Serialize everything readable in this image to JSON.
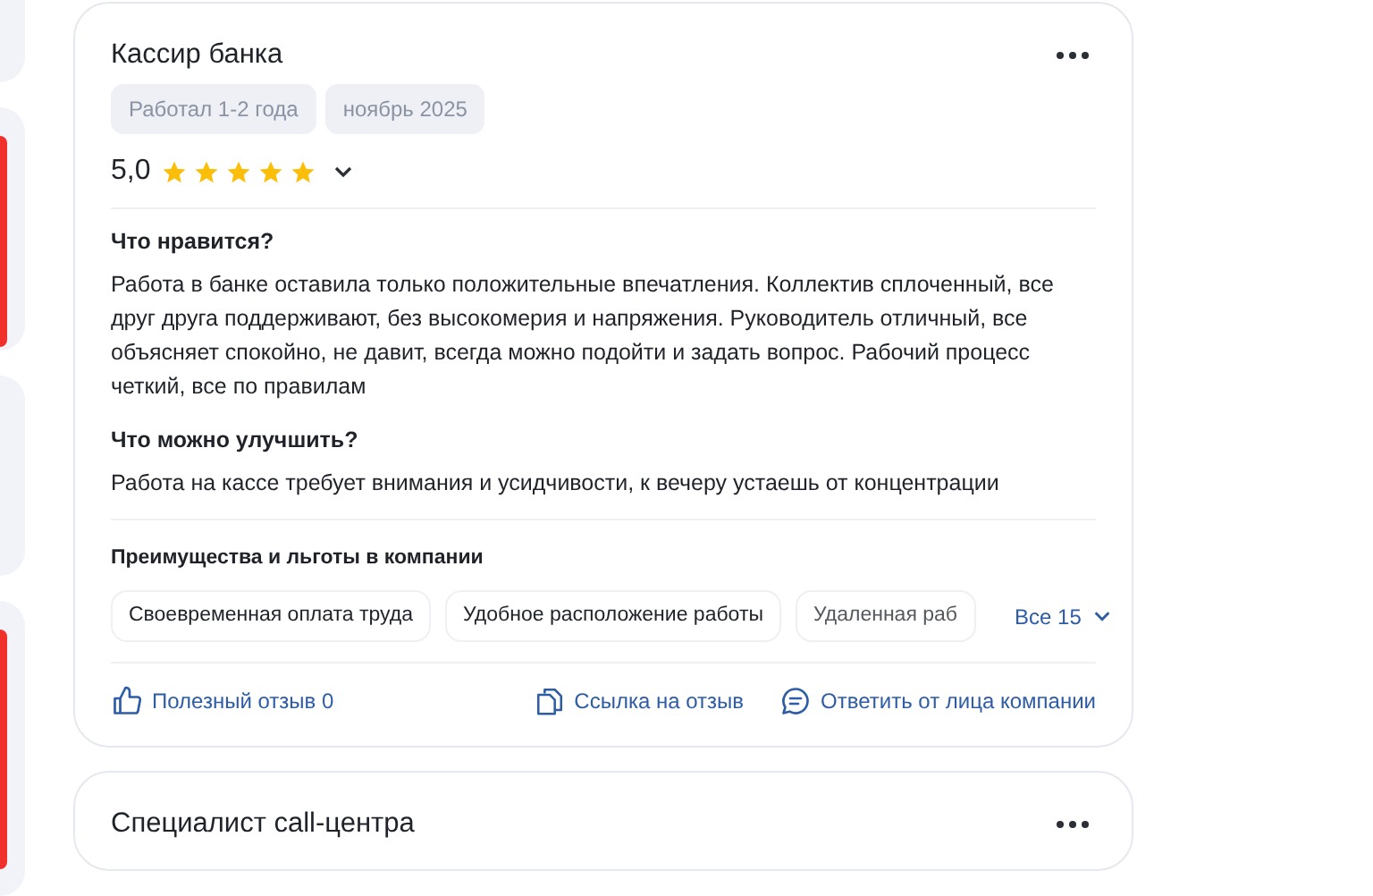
{
  "reviews": [
    {
      "position": "Кассир банка",
      "tags": [
        "Работал 1-2 года",
        "ноябрь 2025"
      ],
      "rating": "5,0",
      "stars": 5,
      "sections": [
        {
          "heading": "Что нравится?",
          "text": "Работа в банке оставила только положительные впечатления. Коллектив сплоченный, все друг друга поддерживают, без высокомерия и напряжения. Руководитель отличный, все объясняет спокойно, не давит, всегда можно подойти и задать вопрос. Рабочий процесс четкий, все по правилам"
        },
        {
          "heading": "Что можно улучшить?",
          "text": "Работа на кассе требует внимания и усидчивости, к вечеру устаешь от концентрации"
        }
      ],
      "benefits_title": "Преимущества и льготы в компании",
      "benefits": [
        "Своевременная оплата труда",
        "Удобное расположение работы",
        "Удаленная раб"
      ],
      "benefits_more": "Все 15",
      "actions": [
        {
          "kind": "like",
          "label": "Полезный отзыв 0"
        },
        {
          "kind": "link",
          "label": "Ссылка на отзыв"
        },
        {
          "kind": "reply",
          "label": "Ответить от лица компании"
        }
      ]
    },
    {
      "position": "Специалист call-центра"
    }
  ]
}
